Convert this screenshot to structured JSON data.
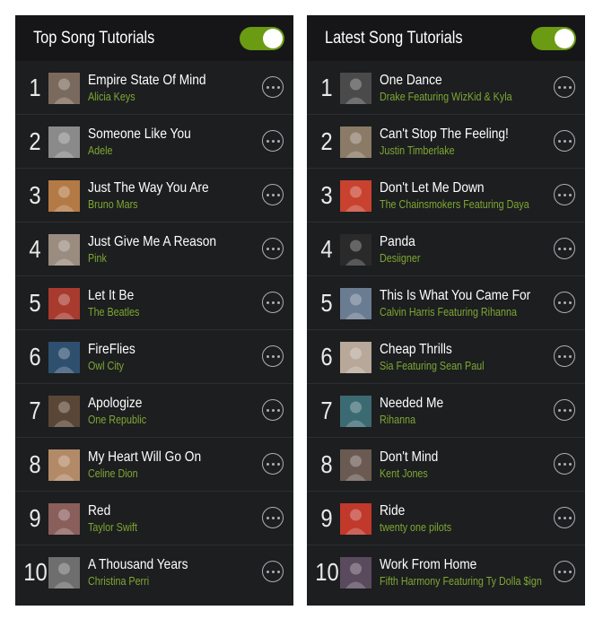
{
  "colors": {
    "panel_bg": "#1d1e20",
    "header_bg": "#161618",
    "accent_green": "#6a9b12",
    "artist_green": "#7ea832",
    "divider": "#2d2e31"
  },
  "panels": [
    {
      "title": "Top Song Tutorials",
      "toggle_on": true,
      "songs": [
        {
          "rank": "1",
          "title": "Empire State Of Mind",
          "artist": "Alicia Keys",
          "thumb_color": "#7a6a5e"
        },
        {
          "rank": "2",
          "title": "Someone Like You",
          "artist": "Adele",
          "thumb_color": "#8a8a8a"
        },
        {
          "rank": "3",
          "title": "Just The Way You Are",
          "artist": "Bruno Mars",
          "thumb_color": "#b37a45"
        },
        {
          "rank": "4",
          "title": "Just Give Me A Reason",
          "artist": "Pink",
          "thumb_color": "#9b8c80"
        },
        {
          "rank": "5",
          "title": "Let It Be",
          "artist": "The Beatles",
          "thumb_color": "#a83a2e"
        },
        {
          "rank": "6",
          "title": "FireFlies",
          "artist": "Owl City",
          "thumb_color": "#2f4f6f"
        },
        {
          "rank": "7",
          "title": "Apologize",
          "artist": "One Republic",
          "thumb_color": "#5a4636"
        },
        {
          "rank": "8",
          "title": "My Heart Will Go On",
          "artist": "Celine Dion",
          "thumb_color": "#b38a68"
        },
        {
          "rank": "9",
          "title": "Red",
          "artist": "Taylor Swift",
          "thumb_color": "#8a5e5a"
        },
        {
          "rank": "10",
          "title": "A Thousand Years",
          "artist": "Christina Perri",
          "thumb_color": "#6e6e6e"
        }
      ]
    },
    {
      "title": "Latest Song Tutorials",
      "toggle_on": true,
      "songs": [
        {
          "rank": "1",
          "title": "One Dance",
          "artist": "Drake Featuring WizKid & Kyla",
          "thumb_color": "#4a4a4a"
        },
        {
          "rank": "2",
          "title": "Can't Stop The Feeling!",
          "artist": "Justin Timberlake",
          "thumb_color": "#8a7a66"
        },
        {
          "rank": "3",
          "title": "Don't Let Me Down",
          "artist": "The Chainsmokers Featuring Daya",
          "thumb_color": "#c8422f"
        },
        {
          "rank": "4",
          "title": "Panda",
          "artist": "Desiigner",
          "thumb_color": "#2a2a2a"
        },
        {
          "rank": "5",
          "title": "This Is What You Came For",
          "artist": "Calvin Harris Featuring Rihanna",
          "thumb_color": "#6a7c92"
        },
        {
          "rank": "6",
          "title": "Cheap Thrills",
          "artist": "Sia Featuring Sean Paul",
          "thumb_color": "#b8a89a"
        },
        {
          "rank": "7",
          "title": "Needed Me",
          "artist": "Rihanna",
          "thumb_color": "#3c6a72"
        },
        {
          "rank": "8",
          "title": "Don't Mind",
          "artist": "Kent Jones",
          "thumb_color": "#6a5a52"
        },
        {
          "rank": "9",
          "title": "Ride",
          "artist": "twenty one pilots",
          "thumb_color": "#c0392b"
        },
        {
          "rank": "10",
          "title": "Work From Home",
          "artist": "Fifth Harmony Featuring Ty Dolla $ign",
          "thumb_color": "#5a4a5e"
        }
      ]
    }
  ]
}
